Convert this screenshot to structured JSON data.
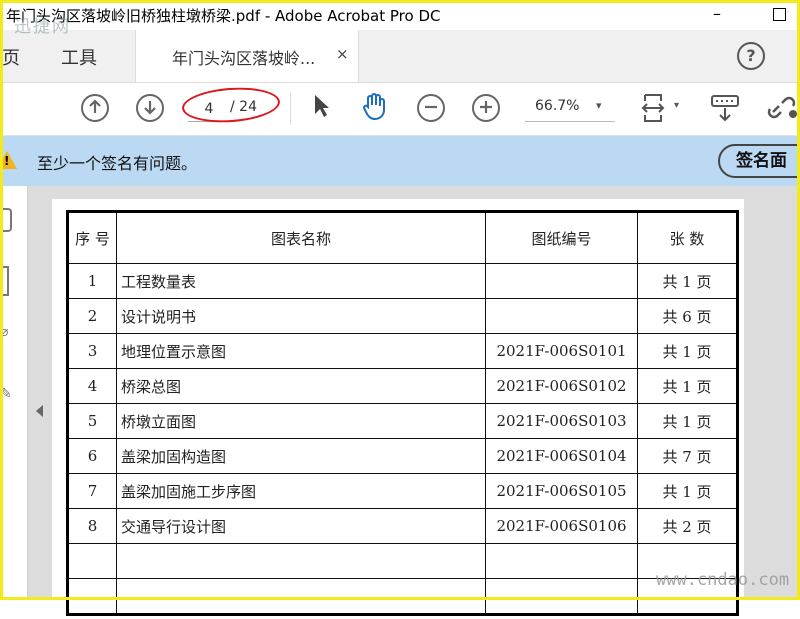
{
  "window": {
    "title": "年门头沟区落坡岭旧桥独柱墩桥梁.pdf - Adobe Acrobat Pro DC",
    "minimize": "–"
  },
  "tabs": {
    "home": "主页",
    "tools": "工具",
    "document": "年门头沟区落坡岭...",
    "close": "×",
    "help": "?"
  },
  "toolbar": {
    "current_page": "4",
    "total_pages": "/ 24",
    "zoom": "66.7%",
    "caret": "▾",
    "icons": [
      "arrow-up-icon",
      "arrow-down-icon",
      "pointer-icon",
      "hand-icon",
      "zoom-out-icon",
      "zoom-in-icon",
      "fit-page-icon",
      "keyboard-icon",
      "link-icon"
    ]
  },
  "warning": {
    "text": "至少一个签名有问题。",
    "button": "签名面",
    "icon": "!"
  },
  "table": {
    "headers": [
      "序 号",
      "图表名称",
      "图纸编号",
      "张 数"
    ],
    "rows": [
      {
        "no": "1",
        "name": "工程数量表",
        "code": "",
        "count": "共 1 页"
      },
      {
        "no": "2",
        "name": "设计说明书",
        "code": "",
        "count": "共 6 页"
      },
      {
        "no": "3",
        "name": "地理位置示意图",
        "code": "2021F-006S0101",
        "count": "共 1 页"
      },
      {
        "no": "4",
        "name": "桥梁总图",
        "code": "2021F-006S0102",
        "count": "共 1 页"
      },
      {
        "no": "5",
        "name": "桥墩立面图",
        "code": "2021F-006S0103",
        "count": "共 1 页"
      },
      {
        "no": "6",
        "name": "盖梁加固构造图",
        "code": "2021F-006S0104",
        "count": "共 7 页"
      },
      {
        "no": "7",
        "name": "盖梁加固施工步序图",
        "code": "2021F-006S0105",
        "count": "共 1 页"
      },
      {
        "no": "8",
        "name": "交通导行设计图",
        "code": "2021F-006S0106",
        "count": "共 2 页"
      },
      {
        "no": "",
        "name": "",
        "code": "",
        "count": ""
      },
      {
        "no": "",
        "name": "",
        "code": "",
        "count": ""
      }
    ]
  },
  "watermarks": {
    "top": "迅捷网",
    "bottom": "www.cndao.com"
  },
  "colors": {
    "frame": "#f2ea1c",
    "warning_bg": "#bcd9f3",
    "annotation": "#e0141c",
    "warning_icon": "#f3b31d"
  }
}
